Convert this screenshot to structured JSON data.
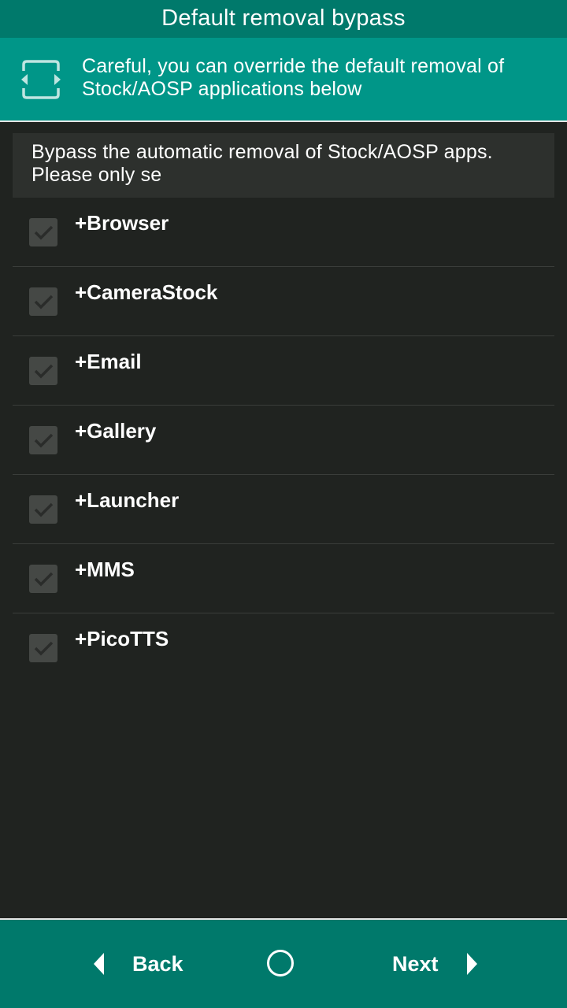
{
  "header": {
    "title": "Default removal bypass"
  },
  "warning": {
    "icon": "resize-icon",
    "line1": "Careful, you can override the default removal of",
    "line2": "Stock/AOSP applications below"
  },
  "description": {
    "line1": "Bypass the automatic removal of Stock/AOSP apps.",
    "line2": "Please only se"
  },
  "apps": [
    {
      "label": "+Browser",
      "checked": true
    },
    {
      "label": "+CameraStock",
      "checked": true
    },
    {
      "label": "+Email",
      "checked": true
    },
    {
      "label": "+Gallery",
      "checked": true
    },
    {
      "label": "+Launcher",
      "checked": true
    },
    {
      "label": "+MMS",
      "checked": true
    },
    {
      "label": "+PicoTTS",
      "checked": true
    }
  ],
  "nav": {
    "back_label": "Back",
    "next_label": "Next"
  },
  "colors": {
    "title_bar": "#00796b",
    "warning_bar": "#009688",
    "background": "#202320"
  }
}
